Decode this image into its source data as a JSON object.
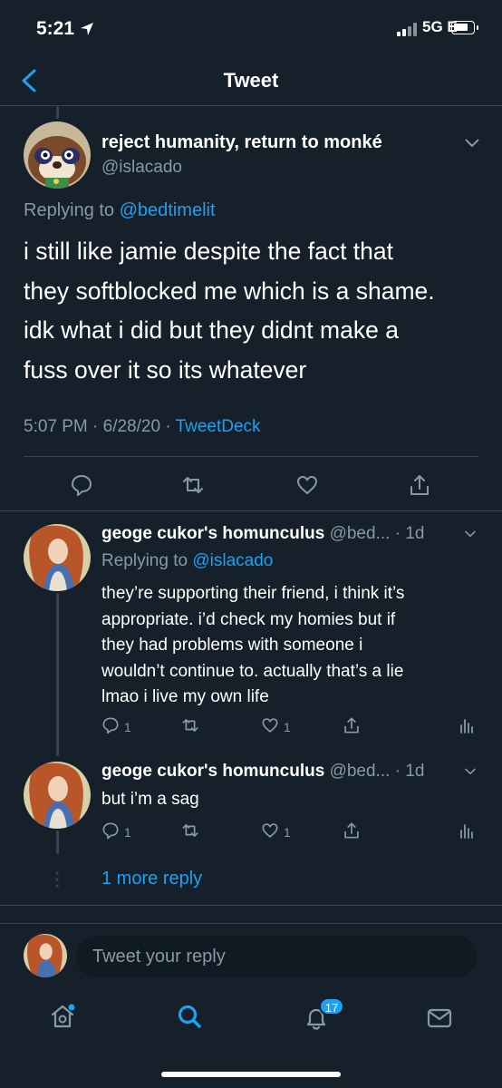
{
  "status_bar": {
    "time": "5:21",
    "network": "5G E"
  },
  "header": {
    "title": "Tweet"
  },
  "main_tweet": {
    "display_name": "reject humanity, return to monké",
    "handle": "@islacado",
    "replying_label": "Replying to",
    "replying_to": "@bedtimelit",
    "text_lines": [
      "i still like jamie despite the fact that",
      "they softblocked me which is a shame.",
      "idk what i did but they didnt make a",
      "fuss over it so its whatever"
    ],
    "timestamp": "5:07 PM · 6/28/20 · ",
    "source": "TweetDeck"
  },
  "replies": [
    {
      "display_name": "geoge cukor's homunculus",
      "handle": "@bed...",
      "age": " · 1d",
      "replying_label": "Replying to",
      "replying_to": "@islacado",
      "text_lines": [
        "they’re supporting their friend, i think it’s",
        "appropriate. i’d check my homies but if",
        "they had problems with someone i",
        "wouldn’t continue to. actually that’s a lie",
        "lmao i live my own life"
      ],
      "reply_count": "1",
      "like_count": "1"
    },
    {
      "display_name": "geoge cukor's homunculus",
      "handle": "@bed...",
      "age": " · 1d",
      "text_lines": [
        "but i’m a sag"
      ],
      "reply_count": "1",
      "like_count": "1"
    }
  ],
  "more_replies": "1 more reply",
  "compose": {
    "placeholder": "Tweet your reply"
  },
  "tab_bar": {
    "notifications_badge": "17"
  },
  "colors": {
    "background": "#15202b",
    "accent": "#1da1f2",
    "muted": "#8899a6",
    "divider": "#38444d"
  },
  "icons": [
    "back-chevron-icon",
    "reply-icon",
    "retweet-icon",
    "like-icon",
    "share-icon",
    "analytics-icon",
    "home-icon",
    "search-icon",
    "notifications-icon",
    "messages-icon"
  ]
}
